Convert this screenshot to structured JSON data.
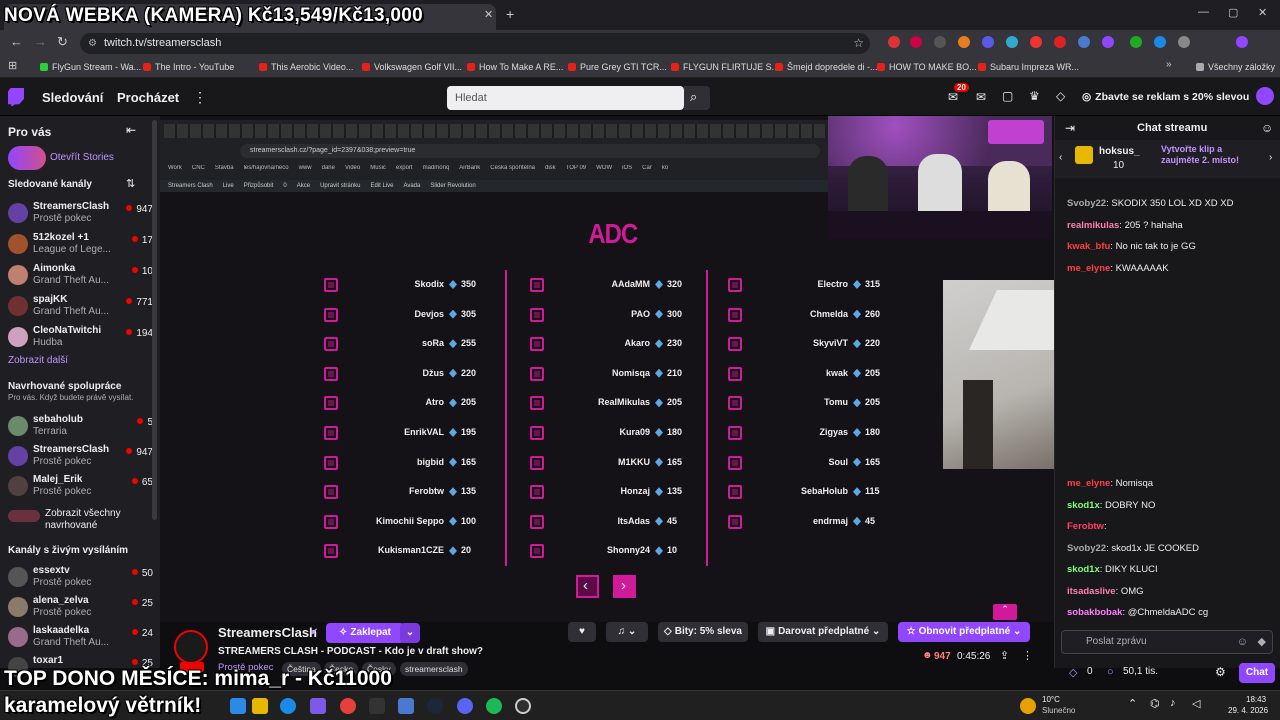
{
  "overlay": {
    "top_text": "NOVÁ WEBKA (KAMERA) Kč13,549/Kč13,000",
    "bottom_line1": "TOP DONO MĚSÍCE: mima_r - Kč11000",
    "bottom_line2": "karamelový větrník!"
  },
  "browser": {
    "url": "twitch.tv/streamersclash",
    "bookmarks": [
      {
        "label": "FlyGun Stream - Wa...",
        "color": "#2ecc40"
      },
      {
        "label": "The Intro - YouTube",
        "color": "#e62117"
      },
      {
        "label": "This Aerobic Video...",
        "color": "#e62117"
      },
      {
        "label": "Volkswagen Golf VII...",
        "color": "#e62117"
      },
      {
        "label": "How To Make A RE...",
        "color": "#e62117"
      },
      {
        "label": "Pure Grey GTI TCR...",
        "color": "#e62117"
      },
      {
        "label": "FLYGUN FLIRTUJE S...",
        "color": "#e62117"
      },
      {
        "label": "Šmejd dopredele di -...",
        "color": "#e62117"
      },
      {
        "label": "HOW TO MAKE BO...",
        "color": "#e62117"
      },
      {
        "label": "Subaru Impreza WR...",
        "color": "#e62117"
      }
    ],
    "all_bookmarks": "Všechny záložky"
  },
  "nav": {
    "following": "Sledování",
    "browse": "Procházet",
    "search_placeholder": "Hledat",
    "notif_count": "20",
    "ad_free": "Zbavte se reklam s 20% slevou"
  },
  "sidebar": {
    "for_you": "Pro vás",
    "open_stories": "Otevřít Stories",
    "followed_header": "Sledované kanály",
    "followed": [
      {
        "name": "StreamersClash",
        "game": "Prostě pokec",
        "viewers": "947",
        "color": "#6441a5"
      },
      {
        "name": "512kozel +1",
        "game": "League of Lege...",
        "viewers": "17",
        "color": "#a0522d"
      },
      {
        "name": "Aimonka",
        "game": "Grand Theft Au...",
        "viewers": "10",
        "color": "#c08070"
      },
      {
        "name": "spajKK",
        "game": "Grand Theft Au...",
        "viewers": "771",
        "color": "#703030"
      },
      {
        "name": "CleoNaTwitchi",
        "game": "Hudba",
        "viewers": "194",
        "color": "#d0a0c0"
      }
    ],
    "show_more": "Zobrazit další",
    "collab_header": "Navrhované spolupráce",
    "collab_sub": "Pro vás. Když budete právě vysílat.",
    "collab": [
      {
        "name": "sebaholub",
        "game": "Terraria",
        "viewers": "5",
        "color": "#6a8a6a"
      },
      {
        "name": "StreamersClash",
        "game": "Prostě pokec",
        "viewers": "947",
        "color": "#6441a5"
      },
      {
        "name": "Malej_Erik",
        "game": "Prostě pokec",
        "viewers": "65",
        "color": "#504040"
      }
    ],
    "show_all_suggested": "Zobrazit všechny navrhované",
    "live_header": "Kanály s živým vysíláním",
    "live": [
      {
        "name": "essextv",
        "game": "Prostě pokec",
        "viewers": "50",
        "color": "#555"
      },
      {
        "name": "alena_zelva",
        "game": "Prostě pokec",
        "viewers": "25",
        "color": "#8a7a6a"
      },
      {
        "name": "laskaadelka",
        "game": "Grand Theft Au...",
        "viewers": "24",
        "color": "#9a6a8a"
      },
      {
        "name": "toxar1",
        "game": "",
        "viewers": "25",
        "color": "#444"
      }
    ]
  },
  "inner_browser": {
    "url": "streamersclash.cz/?page_id=2397&038;preview=true",
    "bookmarks": [
      "Work",
      "CNC",
      "Stavba",
      "les/hajovna/neco",
      "www",
      "dane",
      "Video",
      "Music",
      "export",
      "madmonq",
      "AirBank",
      "Česká spořitelna",
      "disk",
      "TOP 09",
      "WOW",
      "iOS",
      "Car",
      "ko"
    ],
    "wp_bar": [
      "Streamers Clash",
      "Live",
      "Přizpůsobit",
      "0",
      "Akce",
      "Upravit stránku",
      "Edit Live",
      "Avada",
      "Slider Revolution"
    ]
  },
  "page": {
    "section_title": "ADC",
    "columns": [
      [
        {
          "name": "Skodix",
          "points": "350"
        },
        {
          "name": "Devjos",
          "points": "305"
        },
        {
          "name": "soRa",
          "points": "255"
        },
        {
          "name": "Džus",
          "points": "220"
        },
        {
          "name": "Atro",
          "points": "205"
        },
        {
          "name": "EnrikVAL",
          "points": "195"
        },
        {
          "name": "bigbid",
          "points": "165"
        },
        {
          "name": "Ferobtw",
          "points": "135"
        },
        {
          "name": "Kimochii Seppo",
          "points": "100"
        },
        {
          "name": "Kukisman1CZE",
          "points": "20"
        }
      ],
      [
        {
          "name": "AAdaMM",
          "points": "320"
        },
        {
          "name": "PAO",
          "points": "300"
        },
        {
          "name": "Akaro",
          "points": "230"
        },
        {
          "name": "Nomisqa",
          "points": "210"
        },
        {
          "name": "RealMikulas",
          "points": "205"
        },
        {
          "name": "Kura09",
          "points": "180"
        },
        {
          "name": "M1KKU",
          "points": "165"
        },
        {
          "name": "Honzaj",
          "points": "135"
        },
        {
          "name": "ItsAdas",
          "points": "45"
        },
        {
          "name": "Shonny24",
          "points": "10"
        }
      ],
      [
        {
          "name": "Electro",
          "points": "315"
        },
        {
          "name": "Chmelda",
          "points": "260"
        },
        {
          "name": "SkyviVT",
          "points": "220"
        },
        {
          "name": "kwak",
          "points": "205"
        },
        {
          "name": "Tomu",
          "points": "205"
        },
        {
          "name": "Zigyas",
          "points": "180"
        },
        {
          "name": "Soul",
          "points": "165"
        },
        {
          "name": "SebaHolub",
          "points": "115"
        },
        {
          "name": "endrmaj",
          "points": "45"
        }
      ]
    ],
    "prev_arrow": "‹",
    "next_arrow": "›"
  },
  "chat": {
    "title": "Chat streamu",
    "pinned_user": "hoksus_",
    "pinned_count": "10",
    "clip_prompt": "Vytvořte klip a zaujměte 2. místo!",
    "messages_top": [
      {
        "user": "Svoby22",
        "text": "SKODIX 350 LOL XD XD XD",
        "color": "#aaaaaa"
      },
      {
        "user": "realmikulas",
        "text": "205 ? hahaha",
        "color": "#ff7fb0"
      },
      {
        "user": "kwak_bfu",
        "text": "No nic tak to je GG",
        "color": "#ff4040"
      },
      {
        "user": "me_elyne",
        "text": "KWAAAAAK",
        "color": "#ff4040"
      }
    ],
    "messages_bottom": [
      {
        "user": "me_elyne",
        "text": "Nomisqa",
        "color": "#ff4040"
      },
      {
        "user": "skod1x",
        "text": "DOBRY NO",
        "color": "#7fff7f"
      },
      {
        "user": "Ferobtw",
        "text": "",
        "color": "#ff4060"
      },
      {
        "user": "Svoby22",
        "text": "skod1x JE COOKED",
        "color": "#aaaaaa"
      },
      {
        "user": "skod1x",
        "text": "DIKY KLUCI",
        "color": "#7fff7f"
      },
      {
        "user": "itsadaslive",
        "text": "OMG",
        "color": "#ff7fb0"
      },
      {
        "user": "sobakbobak",
        "text": "@ChmeldaADC cg",
        "color": "#ff7fff"
      }
    ],
    "input_placeholder": "Poslat zprávu",
    "points": "0",
    "balance": "50,1 tis.",
    "chat_button": "Chat"
  },
  "stream_info": {
    "channel": "StreamersClash",
    "title": "STREAMERS CLASH - PODCAST - Kdo je v draft show?",
    "category": "Prostě pokec",
    "tags": [
      "Čeština",
      "Česko",
      "Česky",
      "streamersclash"
    ],
    "support": "Zaklepat",
    "bits": "Bity: 5% sleva",
    "gift": "Darovat předplatné",
    "renew": "Obnovit předplatné",
    "viewers": "947",
    "uptime": "0:45:26"
  },
  "taskbar": {
    "weather_temp": "10°C",
    "weather_desc": "Slunečno",
    "time": "18:43",
    "date": "29. 4. 2026"
  }
}
